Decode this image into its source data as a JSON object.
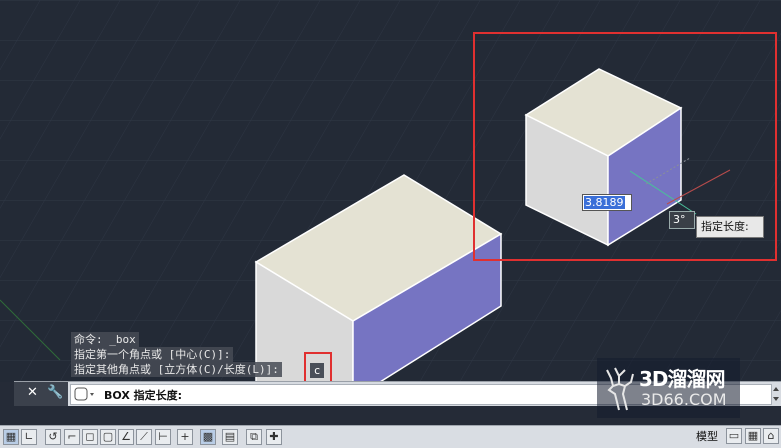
{
  "command_history": [
    "命令: _box",
    "指定第一个角点或 [中心(C)]:",
    "指定其他角点或 [立方体(C)/长度(L)]:"
  ],
  "typed_input": "c",
  "command_line": {
    "prompt": "BOX 指定长度:"
  },
  "dynamic_input": {
    "value": "3.8189",
    "angle": "3°",
    "tooltip": "指定长度:"
  },
  "status": {
    "model_label": "模型"
  },
  "watermark": {
    "main": "3D溜溜网",
    "sub": "3D66.COM"
  },
  "colors": {
    "background": "#232a36",
    "box_top": "#e4e2d3",
    "box_left": "#d9d9d9",
    "box_right": "#7674c2",
    "highlight": "#e03030"
  }
}
